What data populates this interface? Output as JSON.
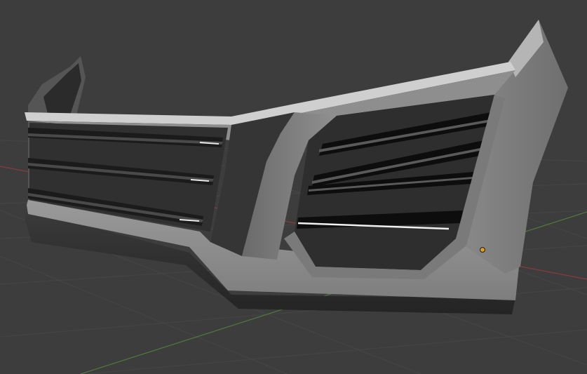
{
  "viewport": {
    "mode": "3d-viewport",
    "background_color": "#3d3d3d",
    "grid_color": "#454545",
    "axis_x_color": "#8a3a3a",
    "axis_y_color": "#4f7a3a",
    "origin_color": "#e6a21a"
  },
  "model": {
    "name": "front-bumper",
    "body_color": "#8c8c8c",
    "dark_color": "#2a2a2a",
    "highlight_color": "#d8d8d8",
    "grille_slat_count": 3,
    "vent_slat_count": 4,
    "selected": false
  }
}
